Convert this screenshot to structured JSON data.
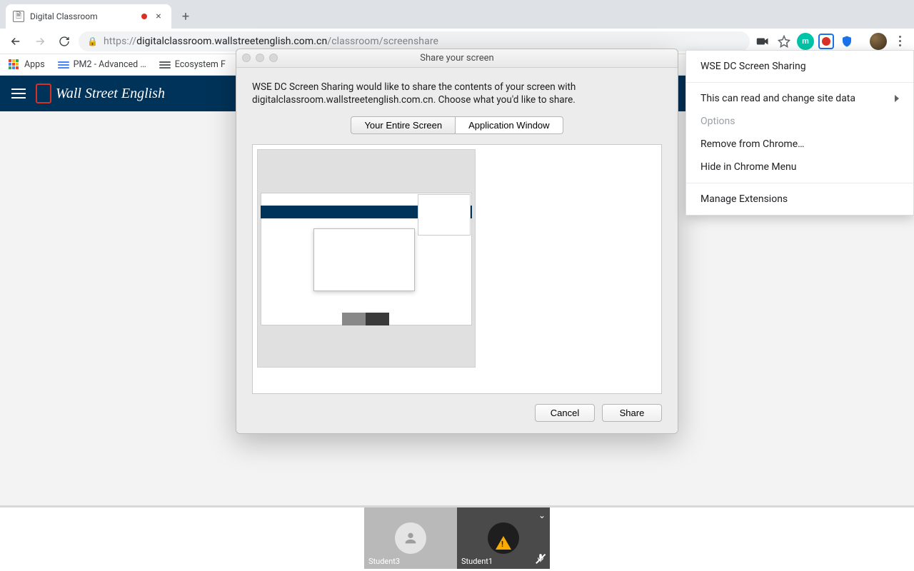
{
  "browser": {
    "tab_title": "Digital Classroom",
    "url_prefix": "https://",
    "url_host": "digitalclassroom.wallstreetenglish.com.cn",
    "url_path": "/classroom/screenshare"
  },
  "bookmarks": {
    "apps": "Apps",
    "pm2": "PM2 - Advanced …",
    "eco": "Ecosystem F"
  },
  "header": {
    "brand": "Wall Street English"
  },
  "dialog": {
    "title": "Share your screen",
    "message": "WSE DC Screen Sharing would like to share the contents of your screen with digitalclassroom.wallstreetenglish.com.cn. Choose what you'd like to share.",
    "tab_entire": "Your Entire Screen",
    "tab_app": "Application Window",
    "cancel": "Cancel",
    "share": "Share"
  },
  "context_menu": {
    "title": "WSE DC Screen Sharing",
    "read": "This can read and change site data",
    "options": "Options",
    "remove": "Remove from Chrome…",
    "hide": "Hide in Chrome Menu",
    "manage": "Manage Extensions"
  },
  "participants": {
    "p1": "Student3",
    "p2": "Student1"
  }
}
